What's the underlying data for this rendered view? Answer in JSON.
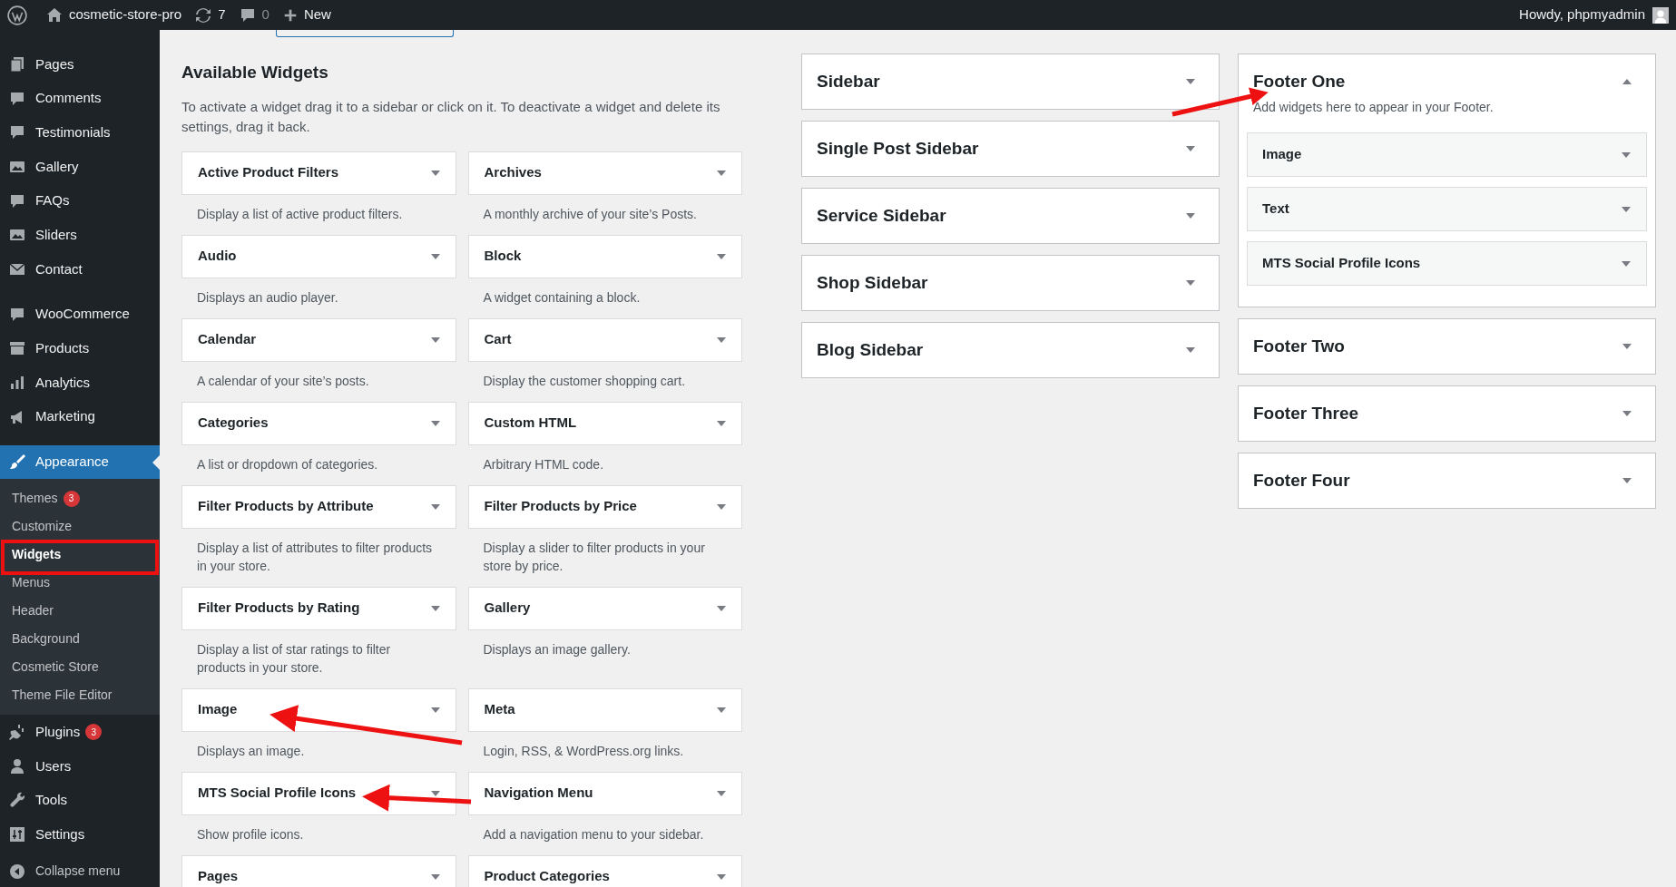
{
  "admin_bar": {
    "site_name": "cosmetic-store-pro",
    "updates": "7",
    "comments": "0",
    "new_label": "New",
    "greeting": "Howdy, phpmyadmin"
  },
  "menu": {
    "groups": [
      [
        {
          "label": "Pages",
          "selected": false
        },
        {
          "label": "Comments",
          "selected": false
        },
        {
          "label": "Testimonials",
          "selected": false
        },
        {
          "label": "Gallery",
          "selected": false
        },
        {
          "label": "FAQs",
          "selected": false
        },
        {
          "label": "Sliders",
          "selected": false
        },
        {
          "label": "Contact",
          "selected": false
        }
      ],
      [
        {
          "label": "WooCommerce",
          "selected": false
        },
        {
          "label": "Products",
          "selected": false
        },
        {
          "label": "Analytics",
          "selected": false
        },
        {
          "label": "Marketing",
          "selected": false
        }
      ],
      [
        {
          "label": "Appearance",
          "selected": true,
          "submenu": [
            {
              "label": "Themes",
              "selected": false,
              "badge": "3"
            },
            {
              "label": "Customize",
              "selected": false
            },
            {
              "label": "Widgets",
              "selected": true
            },
            {
              "label": "Menus",
              "selected": false
            },
            {
              "label": "Header",
              "selected": false
            },
            {
              "label": "Background",
              "selected": false
            },
            {
              "label": "Cosmetic Store",
              "selected": false
            },
            {
              "label": "Theme File Editor",
              "selected": false
            }
          ]
        },
        {
          "label": "Plugins",
          "selected": false,
          "badge": "3"
        },
        {
          "label": "Users",
          "selected": false
        },
        {
          "label": "Tools",
          "selected": false
        },
        {
          "label": "Settings",
          "selected": false
        }
      ]
    ],
    "collapse_label": "Collapse menu"
  },
  "available": {
    "heading": "Available Widgets",
    "description": "To activate a widget drag it to a sidebar or click on it. To deactivate a widget and delete its settings, drag it back.",
    "widgets": [
      {
        "title": "Active Product Filters",
        "description": "Display a list of active product filters."
      },
      {
        "title": "Archives",
        "description": "A monthly archive of your site’s Posts."
      },
      {
        "title": "Audio",
        "description": "Displays an audio player."
      },
      {
        "title": "Block",
        "description": "A widget containing a block."
      },
      {
        "title": "Calendar",
        "description": "A calendar of your site’s posts."
      },
      {
        "title": "Cart",
        "description": "Display the customer shopping cart."
      },
      {
        "title": "Categories",
        "description": "A list or dropdown of categories."
      },
      {
        "title": "Custom HTML",
        "description": "Arbitrary HTML code."
      },
      {
        "title": "Filter Products by Attribute",
        "description": "Display a list of attributes to filter products in your store."
      },
      {
        "title": "Filter Products by Price",
        "description": "Display a slider to filter products in your store by price."
      },
      {
        "title": "Filter Products by Rating",
        "description": "Display a list of star ratings to filter products in your store."
      },
      {
        "title": "Gallery",
        "description": "Displays an image gallery."
      },
      {
        "title": "Image",
        "description": "Displays an image."
      },
      {
        "title": "Meta",
        "description": "Login, RSS, & WordPress.org links."
      },
      {
        "title": "MTS Social Profile Icons",
        "description": "Show profile icons."
      },
      {
        "title": "Navigation Menu",
        "description": "Add a navigation menu to your sidebar."
      },
      {
        "title": "Pages"
      },
      {
        "title": "Product Categories"
      }
    ]
  },
  "sidebar_columns": [
    [
      {
        "title": "Sidebar",
        "expanded": false
      },
      {
        "title": "Single Post Sidebar",
        "expanded": false
      },
      {
        "title": "Service Sidebar",
        "expanded": false
      },
      {
        "title": "Shop Sidebar",
        "expanded": false
      },
      {
        "title": "Blog Sidebar",
        "expanded": false
      }
    ],
    [
      {
        "title": "Footer One",
        "expanded": true,
        "description": "Add widgets here to appear in your Footer.",
        "widgets": [
          "Image",
          "Text",
          "MTS Social Profile Icons"
        ]
      },
      {
        "title": "Footer Two",
        "expanded": false
      },
      {
        "title": "Footer Three",
        "expanded": false
      },
      {
        "title": "Footer Four",
        "expanded": false
      }
    ]
  ]
}
